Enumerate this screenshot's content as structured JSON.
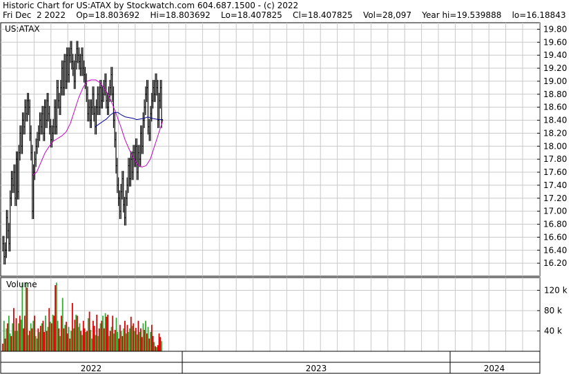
{
  "header": {
    "line1": "Historic Chart for US:ATAX by Stockwatch.com 604.687.1500 - (c) 2022",
    "line2": "Fri Dec  2 2022    Op=18.803692    Hi=18.803692    Lo=18.407825    Cl=18.407825    Vol=28,097    Year hi=19.539888    lo=16.18843"
  },
  "chart_data": [
    {
      "type": "line",
      "title": "US:ATAX",
      "ylim": [
        16.0,
        19.9
      ],
      "y_ticks": [
        "19.80",
        "19.60",
        "19.40",
        "19.20",
        "19.00",
        "18.80",
        "18.60",
        "18.40",
        "18.20",
        "18.00",
        "17.80",
        "17.60",
        "17.40",
        "17.20",
        "17.00",
        "16.80",
        "16.60",
        "16.40",
        "16.20"
      ],
      "x_labels": [
        "2022",
        "2023",
        "2024"
      ],
      "grid": true,
      "series": [
        {
          "kind": "price-bars",
          "color": "#000000",
          "values": [
            16.5,
            16.3,
            16.4,
            16.9,
            16.7,
            16.5,
            17.2,
            17.5,
            17.4,
            17.6,
            17.2,
            17.8,
            17.3,
            17.9,
            18.2,
            18.0,
            18.4,
            18.3,
            18.6,
            18.5,
            18.7,
            18.6,
            18.2,
            17.9,
            17.0,
            17.6,
            17.8,
            18.0,
            18.1,
            18.2,
            18.4,
            18.3,
            18.5,
            18.2,
            18.6,
            18.4,
            18.7,
            18.5,
            18.3,
            18.1,
            18.2,
            18.3,
            18.6,
            18.3,
            18.9,
            18.7,
            18.6,
            18.9,
            19.2,
            18.9,
            19.3,
            19.0,
            19.4,
            19.1,
            19.4,
            19.5,
            19.3,
            19.2,
            19.0,
            19.3,
            19.5,
            19.4,
            19.3,
            19.2,
            19.4,
            19.2,
            19.1,
            19.0,
            18.8,
            18.5,
            18.6,
            18.4,
            18.6,
            18.8,
            18.5,
            18.3,
            18.6,
            18.8,
            18.6,
            18.9,
            18.7,
            18.8,
            18.9,
            19.0,
            18.7,
            18.6,
            18.8,
            18.9,
            19.1,
            18.8,
            18.4,
            18.1,
            17.7,
            17.4,
            17.2,
            17.0,
            17.3,
            17.5,
            17.1,
            16.9,
            17.2,
            17.4,
            17.7,
            17.5,
            17.8,
            17.6,
            17.9,
            17.8,
            18.0,
            17.6,
            17.9,
            17.8,
            18.2,
            18.0,
            18.4,
            18.6,
            18.8,
            18.9,
            18.3,
            18.2,
            18.5,
            18.7,
            18.9,
            18.8,
            19.0,
            18.9,
            18.4,
            18.7,
            18.9,
            18.4
          ]
        },
        {
          "kind": "moving-average",
          "color": "#cc00cc",
          "values": [
            17.55,
            17.6,
            17.75,
            17.9,
            18.0,
            18.08,
            18.12,
            18.16,
            18.22,
            18.35,
            18.55,
            18.75,
            18.9,
            19.0,
            19.02,
            19.02,
            18.98,
            18.9,
            18.8,
            18.65,
            18.48,
            18.3,
            18.1,
            17.95,
            17.82,
            17.72,
            17.68,
            17.7,
            17.8,
            18.0,
            18.2,
            18.4
          ]
        },
        {
          "kind": "moving-average",
          "color": "#000099",
          "values": [
            18.3,
            18.34,
            18.38,
            18.42,
            18.48,
            18.52,
            18.52,
            18.48,
            18.45,
            18.44,
            18.43,
            18.41,
            18.42,
            18.43,
            18.45,
            18.43,
            18.42,
            18.41,
            18.41
          ]
        }
      ]
    },
    {
      "type": "bar",
      "title": "Volume",
      "ylim": [
        0,
        145
      ],
      "y_ticks": [
        "120 k",
        "80 k",
        "40 k"
      ],
      "up_color": "#33aa33",
      "down_color": "#dd0000",
      "values": [
        15,
        60,
        25,
        45,
        55,
        70,
        35,
        30,
        55,
        85,
        40,
        65,
        40,
        55,
        70,
        62,
        135,
        45,
        70,
        135,
        125,
        32,
        40,
        55,
        45,
        60,
        70,
        30,
        25,
        45,
        38,
        50,
        55,
        60,
        38,
        70,
        40,
        48,
        85,
        58,
        55,
        72,
        70,
        130,
        135,
        60,
        45,
        30,
        70,
        105,
        45,
        52,
        58,
        35,
        48,
        25,
        40,
        95,
        45,
        62,
        72,
        70,
        48,
        55,
        40,
        32,
        60,
        45,
        38,
        40,
        65,
        78,
        42,
        25,
        60,
        50,
        32,
        72,
        30,
        45,
        55,
        60,
        70,
        45,
        75,
        68,
        72,
        30,
        40,
        48,
        70,
        35,
        42,
        66,
        38,
        25,
        52,
        40,
        30,
        45,
        60,
        35,
        52,
        38,
        45,
        68,
        50,
        55,
        40,
        46,
        33,
        60,
        38,
        45,
        28,
        55,
        42,
        60,
        35,
        48,
        25,
        38,
        52,
        30,
        18,
        10,
        8,
        12,
        35,
        28,
        20
      ],
      "up": [
        0,
        1,
        0,
        1,
        0,
        1,
        1,
        0,
        1,
        0,
        1,
        0,
        1,
        1,
        0,
        1,
        1,
        0,
        0,
        1,
        0,
        1,
        0,
        1,
        0,
        1,
        0,
        1,
        1,
        0,
        1,
        0,
        1,
        0,
        0,
        1,
        0,
        1,
        0,
        1,
        0,
        1,
        0,
        0,
        1,
        1,
        0,
        1,
        0,
        1,
        0,
        1,
        0,
        0,
        1,
        0,
        1,
        0,
        1,
        0,
        1,
        0,
        1,
        1,
        0,
        1,
        0,
        0,
        1,
        0,
        1,
        0,
        1,
        1,
        0,
        0,
        1,
        0,
        1,
        0,
        1,
        0,
        1,
        0,
        1,
        0,
        0,
        1,
        0,
        1,
        0,
        1,
        0,
        1,
        1,
        0,
        0,
        1,
        0,
        1,
        0,
        1,
        0,
        1,
        1,
        0,
        1,
        0,
        1,
        0,
        1,
        0,
        1,
        0,
        0,
        1,
        0,
        1,
        0,
        1,
        0,
        1,
        0,
        0,
        1,
        0,
        1,
        0,
        0,
        0,
        1
      ]
    }
  ]
}
